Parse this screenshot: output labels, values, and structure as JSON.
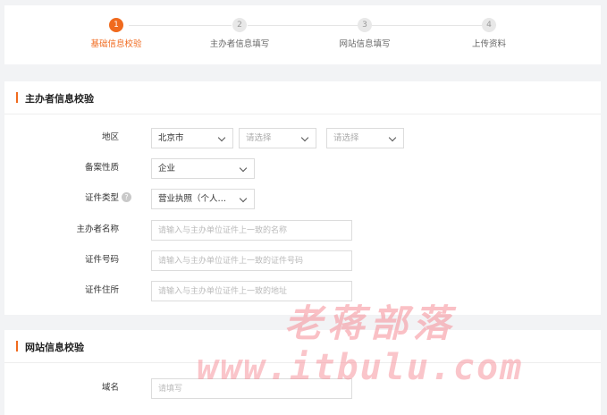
{
  "steps": [
    {
      "num": "1",
      "label": "基础信息校验"
    },
    {
      "num": "2",
      "label": "主办者信息填写"
    },
    {
      "num": "3",
      "label": "网站信息填写"
    },
    {
      "num": "4",
      "label": "上传资料"
    }
  ],
  "steps_active_index": 0,
  "owner_section": {
    "title": "主办者信息校验",
    "region_label": "地区",
    "region_province": "北京市",
    "region_city_placeholder": "请选择",
    "region_district_placeholder": "请选择",
    "nature_label": "备案性质",
    "nature_value": "企业",
    "cert_type_label": "证件类型",
    "cert_type_help": "?",
    "cert_type_value": "营业执照（个人或企业）",
    "name_label": "主办者名称",
    "name_placeholder": "请输入与主办单位证件上一致的名称",
    "cert_no_label": "证件号码",
    "cert_no_placeholder": "请输入与主办单位证件上一致的证件号码",
    "address_label": "证件住所",
    "address_placeholder": "请输入与主办单位证件上一致的地址"
  },
  "site_section": {
    "title": "网站信息校验",
    "domain_label": "域名",
    "domain_placeholder": "请填写"
  },
  "watermark": {
    "cn": "老蒋部落",
    "url": "www.itbulu.com"
  },
  "colors": {
    "accent": "#f06a1e",
    "step_inactive": "#e8e8e8",
    "border": "#dcdcdc",
    "page_bg": "#f2f3f5"
  }
}
